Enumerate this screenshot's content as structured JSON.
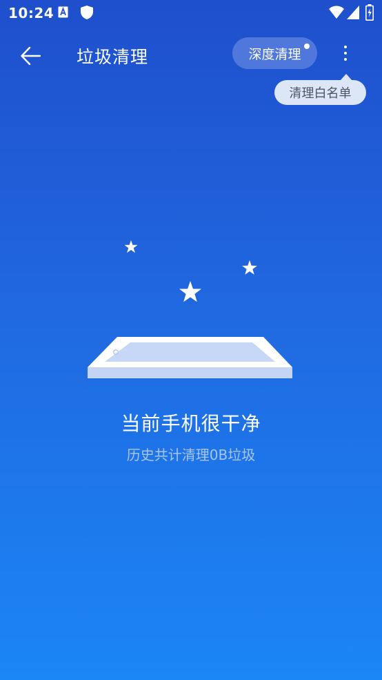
{
  "status_bar": {
    "time": "10:24",
    "icons": [
      "a-notification-icon",
      "shield-icon",
      "wifi-icon",
      "signal-icon",
      "battery-icon"
    ]
  },
  "app_bar": {
    "title": "垃圾清理",
    "deep_clean_label": "深度清理",
    "back_icon": "arrow-left-icon",
    "more_icon": "more-vert-icon"
  },
  "tooltip": {
    "text": "清理白名单"
  },
  "illustration": {
    "icons": [
      "star-icon",
      "star-icon",
      "star-icon",
      "clean-tray-icon"
    ]
  },
  "status": {
    "headline": "当前手机很干净",
    "history": "历史共计清理0B垃圾"
  },
  "colors": {
    "background_top": "#1f4fcc",
    "background_bottom": "#1b86f6",
    "tooltip_bg": "#dde6f7",
    "subtext": "#a9c5f3"
  }
}
